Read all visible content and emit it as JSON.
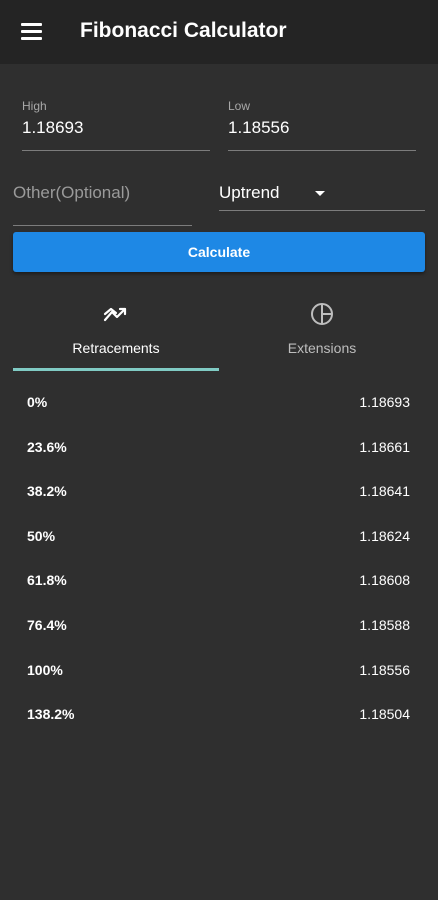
{
  "app_bar": {
    "title": "Fibonacci Calculator",
    "menu_icon": "hamburger-menu-icon"
  },
  "inputs": {
    "high": {
      "label": "High",
      "value": "1.18693"
    },
    "low": {
      "label": "Low",
      "value": "1.18556"
    },
    "other": {
      "placeholder": "Other(Optional)",
      "value": ""
    },
    "trend": {
      "selected": "Uptrend"
    }
  },
  "calculate_button": {
    "label": "Calculate",
    "color": "#1e88e5"
  },
  "tabs": [
    {
      "label": "Retracements",
      "icon": "trend-retracement-icon",
      "active": true
    },
    {
      "label": "Extensions",
      "icon": "pie-chart-icon",
      "active": false
    }
  ],
  "tab_indicator_color": "#80cbc4",
  "levels": [
    {
      "pct": "0%",
      "value": "1.18693"
    },
    {
      "pct": "23.6%",
      "value": "1.18661"
    },
    {
      "pct": "38.2%",
      "value": "1.18641"
    },
    {
      "pct": "50%",
      "value": "1.18624"
    },
    {
      "pct": "61.8%",
      "value": "1.18608"
    },
    {
      "pct": "76.4%",
      "value": "1.18588"
    },
    {
      "pct": "100%",
      "value": "1.18556"
    },
    {
      "pct": "138.2%",
      "value": "1.18504"
    }
  ]
}
